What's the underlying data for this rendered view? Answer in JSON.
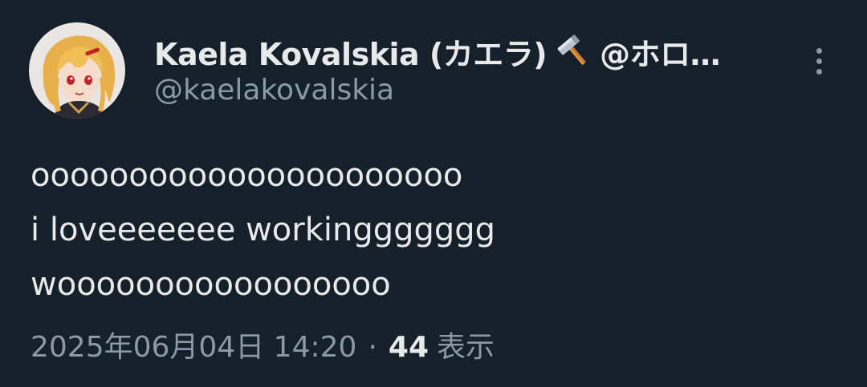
{
  "author": {
    "display_name": "Kaela Kovalskia (カエラ)",
    "name_suffix": "@ホロ…",
    "handle": "@kaelakovalskia",
    "avatar_icon": "avatar-anime-character",
    "badge_icon": "hammer-icon"
  },
  "tweet": {
    "lines": [
      "oooooooooooooooooooooo",
      "i loveeeeeee workinggggggg",
      "wooooooooooooooooo"
    ]
  },
  "meta": {
    "timestamp": "2025年06月04日 14:20",
    "separator": "·",
    "views_count": "44",
    "views_label": "表示"
  },
  "colors": {
    "background": "#15202b",
    "primary_text": "#e7e9ea",
    "secondary_text": "#8b98a5"
  }
}
